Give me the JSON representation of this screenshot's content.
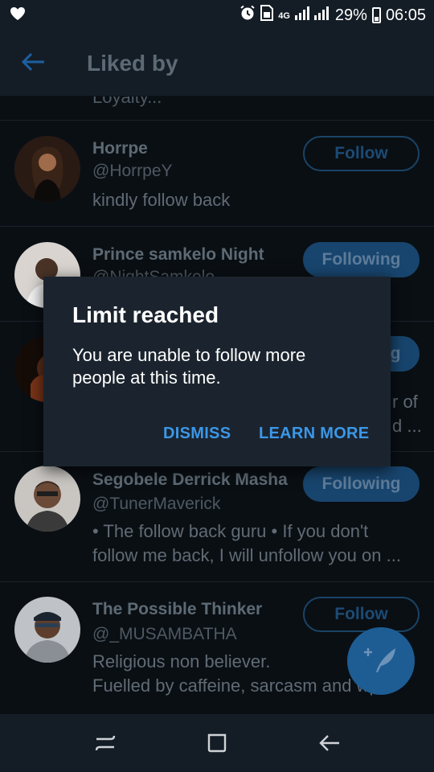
{
  "status_bar": {
    "network": "4G",
    "battery": "29%",
    "time": "06:05"
  },
  "app_bar": {
    "title": "Liked by"
  },
  "list": {
    "clipped_text": "Loyalty...",
    "users": [
      {
        "name": "Horrpe",
        "handle": "@HorrpeY",
        "bio": "kindly follow back",
        "button": "Follow"
      },
      {
        "name": "Prince samkelo Night",
        "handle": "@NightSamkelo",
        "button": "Following"
      },
      {
        "button": "Following",
        "bio_fragment_1": "r of",
        "bio_fragment_2": "d ..."
      },
      {
        "name": "Segobele Derrick Masha",
        "handle": "@TunerMaverick",
        "bio_line1": "• The follow back guru • If you don't",
        "bio_line2": "follow me back, I will unfollow you on ...",
        "button": "Following"
      },
      {
        "name": "The Possible Thinker",
        "handle": "@_MUSAMBATHA",
        "bio_line1": "Religious non believer.",
        "bio_line2": "Fuelled by caffeine, sarcasm and wp...",
        "button": "Follow"
      }
    ]
  },
  "dialog": {
    "title": "Limit reached",
    "message": "You are unable to follow more people at this time.",
    "dismiss": "DISMISS",
    "learn_more": "LEARN MORE"
  },
  "colors": {
    "accent": "#3b97e8",
    "background": "#0a0f14",
    "bar": "#141d26",
    "dialog": "#1b242e"
  },
  "icons": {
    "status_left": "heart-icon",
    "alarm": "alarm-icon",
    "sim": "sim-icon",
    "signal": "signal-icon",
    "battery": "battery-icon",
    "back": "arrow-left-icon",
    "fab": "compose-feather-icon",
    "nav_recent": "recent-apps-icon",
    "nav_home": "home-icon",
    "nav_back": "back-icon"
  }
}
